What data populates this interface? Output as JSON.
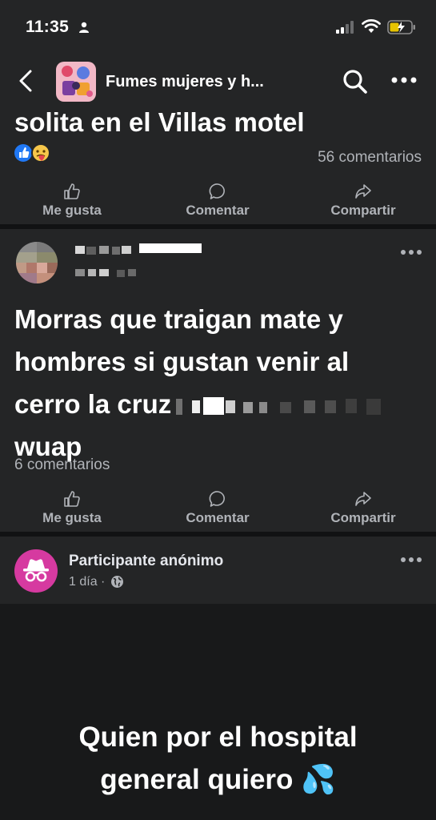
{
  "status_bar": {
    "time": "11:35"
  },
  "header": {
    "group_name": "Fumes mujeres y h..."
  },
  "post1": {
    "text": "solita en el Villas motel",
    "comments": "56 comentarios"
  },
  "actions": {
    "like": "Me gusta",
    "comment": "Comentar",
    "share": "Compartir"
  },
  "post2": {
    "text_line1": "Morras que traigan mate y",
    "text_line2": "hombres si gustan venir al",
    "text_line3": "cerro la cruz",
    "text_line4": "wuap",
    "comments": "6 comentarios"
  },
  "post3": {
    "author": "Participante anónimo",
    "time": "1 día ·"
  },
  "overlay": {
    "line1": "Quien por el hospital",
    "line2": "general quiero 💦"
  },
  "colors": {
    "anon_avatar": "#d63aa0",
    "background": "#18191a",
    "card": "#242526"
  }
}
